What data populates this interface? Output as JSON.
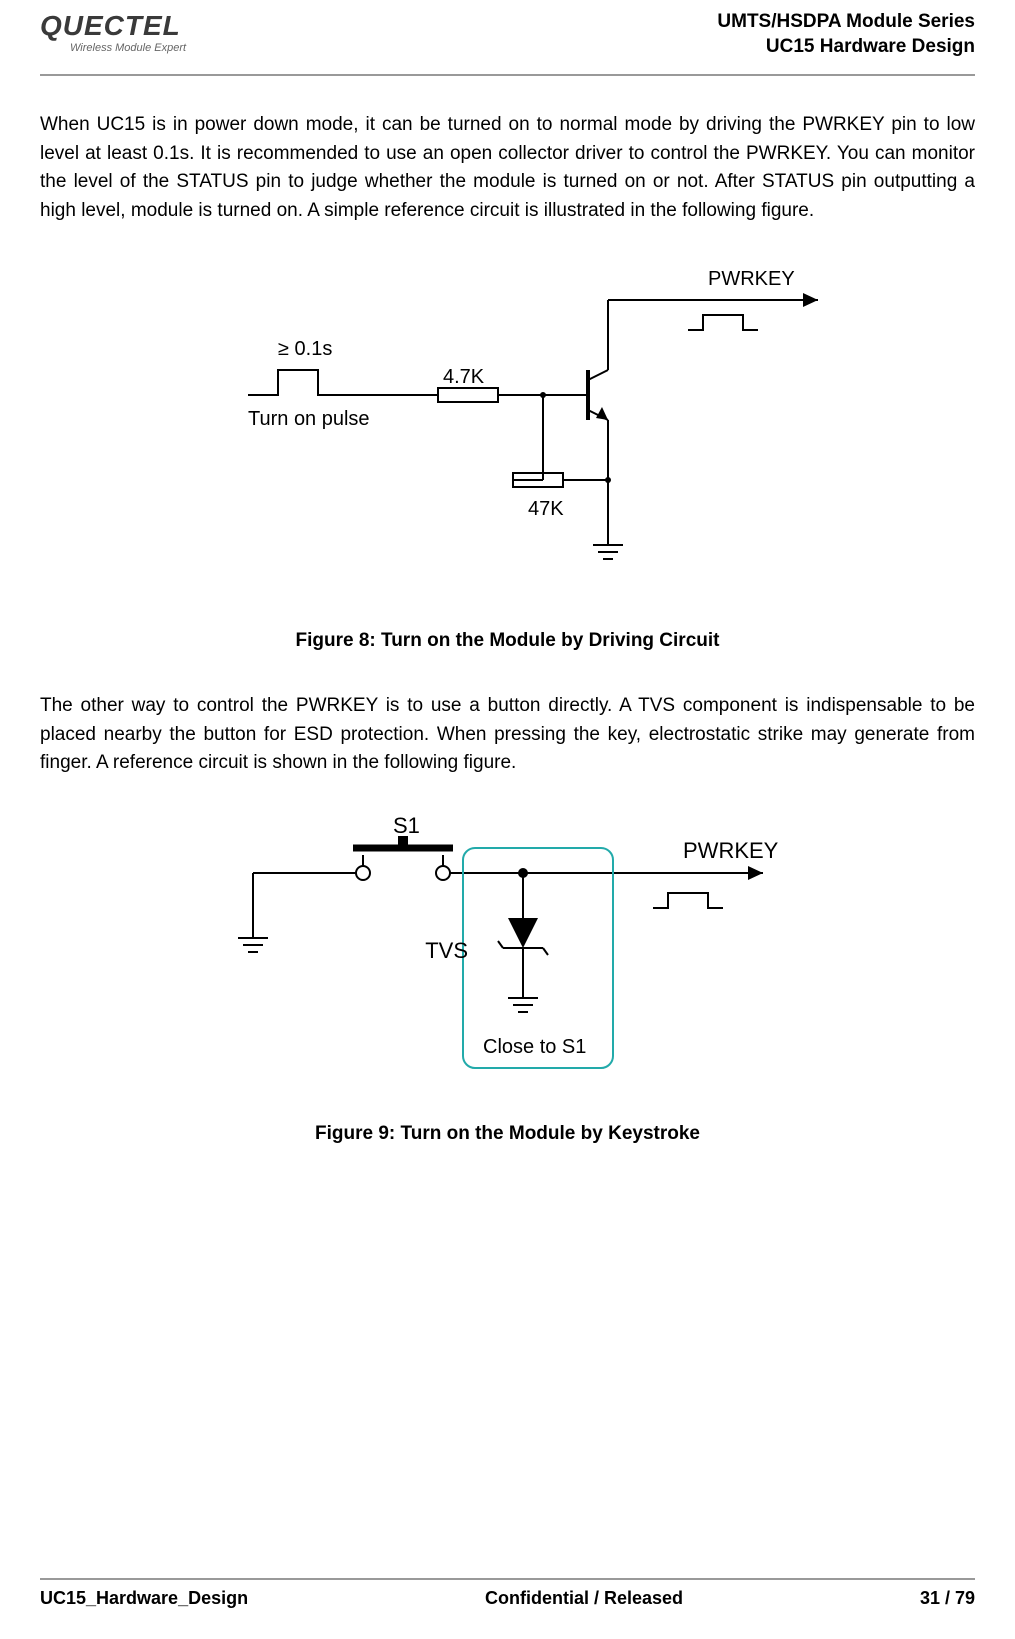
{
  "header": {
    "logo_text": "QUECTEL",
    "logo_sub": "Wireless Module Expert",
    "series": "UMTS/HSDPA  Module  Series",
    "title": "UC15  Hardware  Design"
  },
  "para1": "When UC15 is in power down mode, it can be turned on to normal mode by driving the PWRKEY pin to low level at least 0.1s. It is recommended to use an open collector driver to control the PWRKEY. You can monitor the level of the STATUS pin to judge whether the module is turned on or not. After STATUS pin outputting a high level, module is turned on. A simple reference circuit is illustrated in the following figure.",
  "figure8": {
    "label_pwrkey": "PWRKEY",
    "label_time": "≥ 0.1s",
    "label_pulse": "Turn on pulse",
    "label_r1": "4.7K",
    "label_r2": "47K",
    "caption": "Figure 8: Turn on the Module by Driving Circuit"
  },
  "para2": "The other way to control the PWRKEY is to use a button directly. A TVS component is indispensable to be placed nearby the button for ESD protection. When pressing the key, electrostatic strike may generate from finger. A reference circuit is shown in the following figure.",
  "figure9": {
    "label_s1": "S1",
    "label_tvs": "TVS",
    "label_close": "Close to S1",
    "label_pwrkey": "PWRKEY",
    "caption": "Figure 9: Turn on the Module by Keystroke"
  },
  "footer": {
    "left": "UC15_Hardware_Design",
    "center": "Confidential / Released",
    "right": "31 / 79"
  }
}
